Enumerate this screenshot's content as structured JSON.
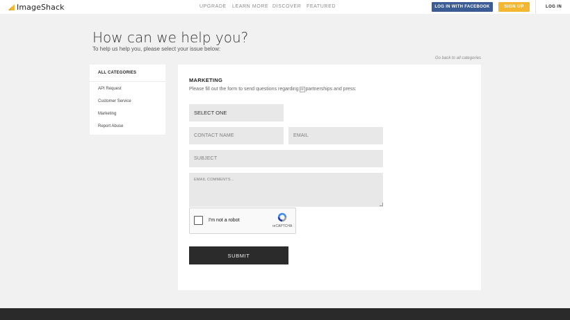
{
  "header": {
    "logo_text": "ImageShack",
    "nav": [
      "UPGRADE",
      "LEARN MORE",
      "DISCOVER",
      "FEATURED"
    ],
    "facebook_login": "LOG IN WITH FACEBOOK",
    "signup": "SIGN UP",
    "login": "LOG IN"
  },
  "page": {
    "title": "How can we help you?",
    "subtitle": "To help us help you, please select your issue below:",
    "back_link": "Go back to all categories"
  },
  "sidebar": {
    "heading": "ALL CATEGORIES",
    "items": [
      "API Request",
      "Customer Service",
      "Marketing",
      "Report Abuse"
    ]
  },
  "form": {
    "title": "MARKETING",
    "desc_before": "Please fill out the form to send questions regarding",
    "desc_glyph": "⌧",
    "desc_after": "partnerships and press:",
    "select_value": "SELECT ONE",
    "contact_placeholder": "CONTACT NAME",
    "email_placeholder": "EMAIL",
    "subject_placeholder": "SUBJECT",
    "comments_placeholder": "EMAIL COMMENTS...",
    "captcha_label": "I'm not a robot",
    "captcha_brand": "reCAPTCHA",
    "submit": "SUBMIT"
  },
  "colors": {
    "facebook_blue": "#3b5b95",
    "signup_yellow": "#f4b731",
    "submit_dark": "#2b2b2b",
    "page_background": "#f1f1f1"
  },
  "icons": [
    "imageshack-logo-icon",
    "recaptcha-logo-icon"
  ]
}
